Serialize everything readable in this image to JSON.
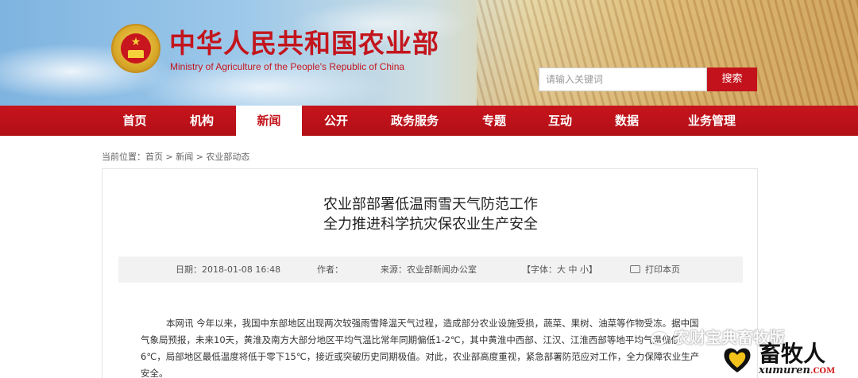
{
  "header": {
    "title_cn": "中华人民共和国农业部",
    "title_en": "Ministry of Agriculture of the People's Republic of China",
    "search_placeholder": "请输入关键词",
    "search_button": "搜索"
  },
  "nav": {
    "items": [
      {
        "label": "首页",
        "active": false
      },
      {
        "label": "机构",
        "active": false
      },
      {
        "label": "新闻",
        "active": true
      },
      {
        "label": "公开",
        "active": false
      },
      {
        "label": "政务服务",
        "active": false
      },
      {
        "label": "专题",
        "active": false
      },
      {
        "label": "互动",
        "active": false
      },
      {
        "label": "数据",
        "active": false
      },
      {
        "label": "业务管理",
        "active": false
      }
    ]
  },
  "breadcrumb": "当前位置：首页 > 新闻 > 农业部动态",
  "article": {
    "title_line1": "农业部部署低温雨雪天气防范工作",
    "title_line2": "全力推进科学抗灾保农业生产安全",
    "meta": {
      "date": "日期：2018-01-08 16:48",
      "author": "作者：",
      "source": "来源：农业部新闻办公室",
      "font_size": "【字体：大 中 小】",
      "print": "打印本页"
    },
    "body_lines": [
      "本网讯 今年以来，我国中东部地区出现两次较强雨雪降温天气过程，造成部分农业设施受损，蔬菜、果树、油菜等作物受冻。据中国",
      "气象局预报，未来10天，黄淮及南方大部分地区平均气温比常年同期偏低1-2℃，其中黄淮中西部、江汉、江淮西部等地平均气温偏低",
      "6℃，局部地区最低温度将低于零下15℃，接近或突破历史同期极值。对此，农业部高度重视，紧急部署防范应对工作，全力保障农业生产",
      "安全。"
    ]
  },
  "watermark": {
    "text": "农财宝典畜牧版",
    "logo_cn": "畜牧人",
    "logo_en": "xumuren",
    "logo_com": ".COM"
  },
  "colors": {
    "brand_red": "#c3151d",
    "nav_red": "#b8121a"
  }
}
